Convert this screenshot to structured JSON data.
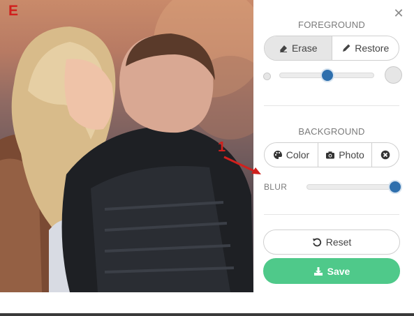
{
  "corner_label": "E",
  "annotation": {
    "number": "1"
  },
  "close_icon": "close-icon",
  "foreground": {
    "title": "FOREGROUND",
    "options": [
      {
        "label": "Erase",
        "icon": "eraser-icon",
        "active": true
      },
      {
        "label": "Restore",
        "icon": "pencil-icon",
        "active": false
      }
    ],
    "brush_size_value": 0.51
  },
  "background": {
    "title": "BACKGROUND",
    "options": [
      {
        "label": "Color",
        "icon": "palette-icon"
      },
      {
        "label": "Photo",
        "icon": "camera-icon"
      },
      {
        "label": "",
        "icon": "remove-circle-icon"
      }
    ],
    "blur_label": "BLUR",
    "blur_value": 1.0
  },
  "actions": {
    "reset_label": "Reset",
    "save_label": "Save"
  },
  "colors": {
    "save_button": "#4fc98a",
    "slider_thumb": "#2e6fad",
    "annotation": "#d0201d"
  }
}
